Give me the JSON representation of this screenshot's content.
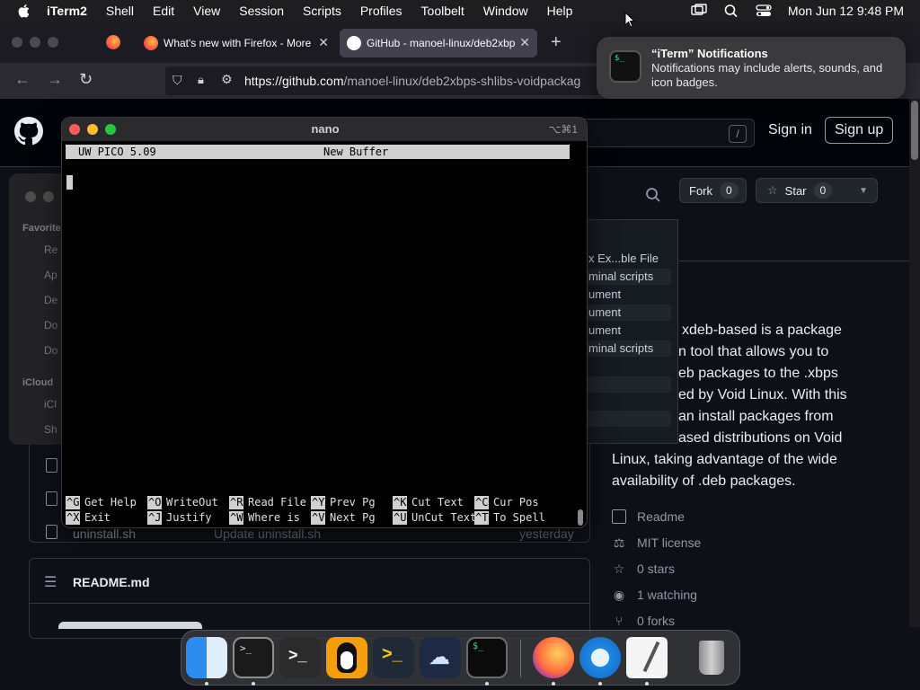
{
  "menubar": {
    "app_name": "iTerm2",
    "menus": [
      "Shell",
      "Edit",
      "View",
      "Session",
      "Scripts",
      "Profiles",
      "Toolbelt",
      "Window",
      "Help"
    ],
    "clock": "Mon Jun 12  9:48 PM"
  },
  "browser": {
    "tabs": [
      {
        "label": "What's new with Firefox - More",
        "active": false
      },
      {
        "label": "GitHub - manoel-linux/deb2xbp",
        "active": true
      }
    ],
    "new_tab": "+",
    "url_domain": "https://github.com",
    "url_path": "/manoel-linux/deb2xbps-shlibs-voidpackag"
  },
  "github": {
    "search_key": "/",
    "sign_in": "Sign in",
    "sign_up": "Sign up",
    "fork_label": "Fork",
    "fork_count": "0",
    "star_label": "Star",
    "star_count": "0",
    "about_text": "xdeb-based is a package tool that allows you to deb packages to the .xbps ed by Void Linux. With this an install packages from ased distributions on Void Linux, taking advantage of the wide availability of .deb packages.",
    "about_lines": [
      "xdeb-based is a package",
      "n tool that allows you to",
      "eb packages to the .xbps",
      "ed by Void Linux. With this",
      "an install packages from",
      "ased distributions on Void",
      "Linux, taking advantage of the wide",
      "availability of .deb packages."
    ],
    "links": [
      "Readme",
      "MIT license",
      "0 stars",
      "1 watching",
      "0 forks"
    ],
    "readme_title": "README.md",
    "file_partial": "uninstall.sh",
    "commit_partial": "Update uninstall.sh",
    "date_partial": "yesterday"
  },
  "dropdown": {
    "items": [
      "x Ex...ble File",
      "minal scripts",
      "ument",
      "ument",
      "ument",
      "minal scripts"
    ]
  },
  "finder": {
    "favorites_header": "Favorite",
    "icloud_header": "iCloud",
    "items": [
      "Re",
      "Ap",
      "De",
      "Do",
      "Do"
    ],
    "icloud_items": [
      "iCl",
      "Sh"
    ]
  },
  "iterm": {
    "title": "nano",
    "shortcut": "⌥⌘1",
    "nano_version": "UW PICO 5.09",
    "buffer_name": "New Buffer",
    "shortcuts_row1": [
      {
        "key": "^G",
        "label": "Get Help"
      },
      {
        "key": "^O",
        "label": "WriteOut"
      },
      {
        "key": "^R",
        "label": "Read File"
      },
      {
        "key": "^Y",
        "label": "Prev Pg"
      },
      {
        "key": "^K",
        "label": "Cut Text"
      },
      {
        "key": "^C",
        "label": "Cur Pos"
      }
    ],
    "shortcuts_row2": [
      {
        "key": "^X",
        "label": "Exit"
      },
      {
        "key": "^J",
        "label": "Justify"
      },
      {
        "key": "^W",
        "label": "Where is"
      },
      {
        "key": "^V",
        "label": "Next Pg"
      },
      {
        "key": "^U",
        "label": "UnCut Text"
      },
      {
        "key": "^T",
        "label": "To Spell"
      }
    ]
  },
  "notification": {
    "title": "“iTerm” Notifications",
    "body": "Notifications may include alerts, sounds, and icon badges."
  },
  "dock": {
    "apps": [
      "finder-icon",
      "terminal-icon",
      "iterm-dark-icon",
      "tux-icon",
      "powershell-icon",
      "cloud-app-icon",
      "iterm-icon",
      "firefox-icon",
      "safari-icon",
      "textedit-icon",
      "trash-icon"
    ]
  },
  "colors": {
    "github_bg": "#0d1117",
    "menubar_bg": "#1e1e20",
    "nano_inverse": "#d0d0d0"
  }
}
